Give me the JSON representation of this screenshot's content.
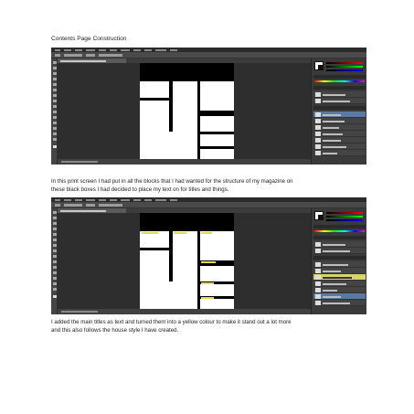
{
  "heading": "Contents Page Construction",
  "paragraph_1": {
    "line_1": "In this print screen I had put in all the blocks that I had wanted for the structure of my magazine on",
    "line_2": "these black boxes I had decided to place my text on for titles and things."
  },
  "paragraph_2": {
    "line_1": "I added the main titles as text and turned them into a yellow colour to make it stand out a lot more",
    "line_2": "and this also follows the house style I have created."
  },
  "colors": {
    "photoshop_ui": "#3c3c3c",
    "title_yellow": "#e8d84a",
    "selected_layer": "#5a7aa3"
  }
}
